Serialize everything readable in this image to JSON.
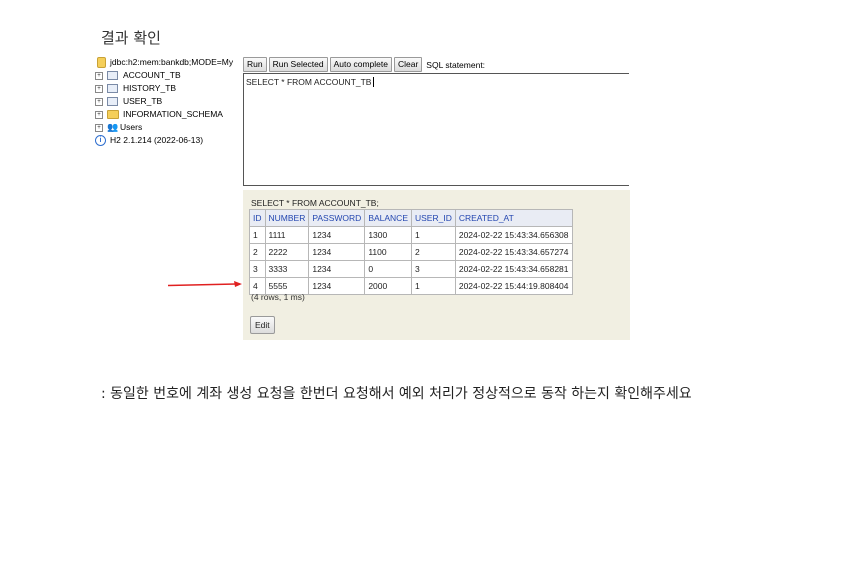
{
  "heading": "결과 확인",
  "tree": {
    "connection": "jdbc:h2:mem:bankdb;MODE=My",
    "items": [
      {
        "label": "ACCOUNT_TB",
        "icon": "table-icon"
      },
      {
        "label": "HISTORY_TB",
        "icon": "table-icon"
      },
      {
        "label": "USER_TB",
        "icon": "table-icon"
      },
      {
        "label": "INFORMATION_SCHEMA",
        "icon": "folder-icon"
      },
      {
        "label": "Users",
        "icon": "users-icon"
      }
    ],
    "version": "H2 2.1.214 (2022-06-13)"
  },
  "toolbar": {
    "run": "Run",
    "run_selected": "Run Selected",
    "auto_complete": "Auto complete",
    "clear": "Clear",
    "sql_label": "SQL statement:"
  },
  "editor": {
    "text": "SELECT * FROM ACCOUNT_TB"
  },
  "result": {
    "query": "SELECT * FROM ACCOUNT_TB;",
    "columns": [
      "ID",
      "NUMBER",
      "PASSWORD",
      "BALANCE",
      "USER_ID",
      "CREATED_AT"
    ],
    "rows": [
      [
        "1",
        "1111",
        "1234",
        "1300",
        "1",
        "2024-02-22 15:43:34.656308"
      ],
      [
        "2",
        "2222",
        "1234",
        "1100",
        "2",
        "2024-02-22 15:43:34.657274"
      ],
      [
        "3",
        "3333",
        "1234",
        "0",
        "3",
        "2024-02-22 15:43:34.658281"
      ],
      [
        "4",
        "5555",
        "1234",
        "2000",
        "1",
        "2024-02-22 15:44:19.808404"
      ]
    ],
    "rows_info": "(4 rows, 1 ms)",
    "edit": "Edit"
  },
  "arrow_color": "#e02020",
  "note": ": 동일한 번호에 계좌 생성 요청을 한번더 요청해서 예외 처리가 정상적으로 동작 하는지 확인해주세요"
}
